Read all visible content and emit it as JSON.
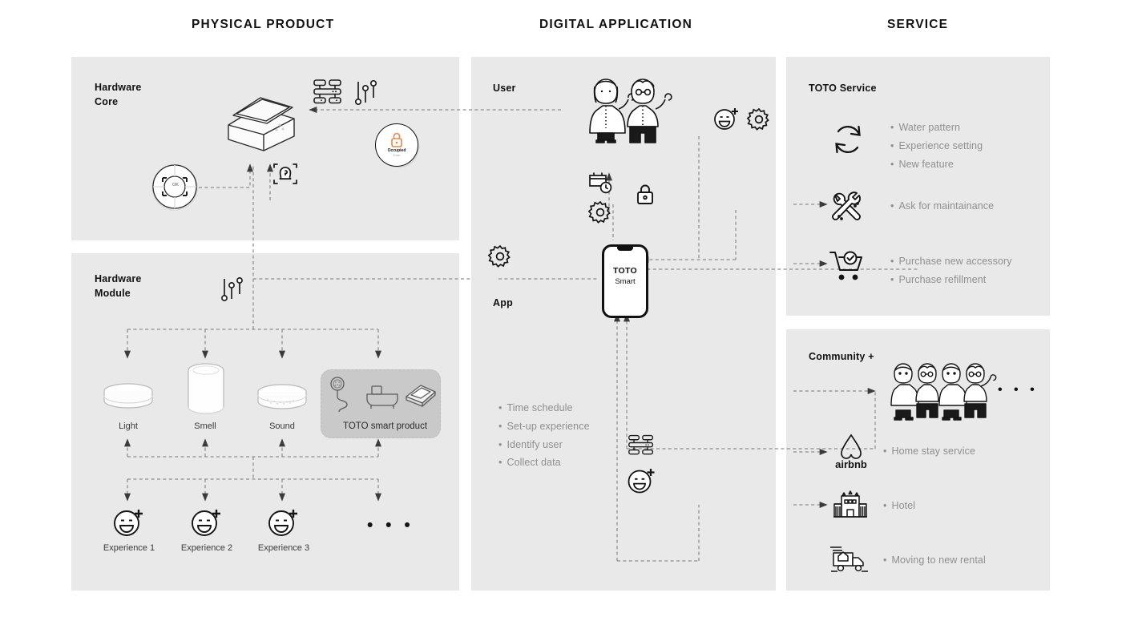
{
  "columns": [
    {
      "id": "physical",
      "label": "PHYSICAL PRODUCT"
    },
    {
      "id": "digital",
      "label": "DIGITAL APPLICATION"
    },
    {
      "id": "service",
      "label": "SERVICE"
    }
  ],
  "hardware_core": {
    "title_line1": "Hardware",
    "title_line2": "Core",
    "remote_label": "OK",
    "badge": {
      "title": "Occupied",
      "subtitle": "8 min"
    },
    "icons": [
      "server-stack-icon",
      "sliders-icon",
      "smart-toilet-icon",
      "dpad-remote-icon",
      "face-scan-icon",
      "lock-badge-icon"
    ]
  },
  "hardware_module": {
    "title_line1": "Hardware",
    "title_line2": "Module",
    "modules": [
      {
        "label": "Light",
        "icon": "light-puck-icon"
      },
      {
        "label": "Smell",
        "icon": "diffuser-icon"
      },
      {
        "label": "Sound",
        "icon": "speaker-puck-icon"
      }
    ],
    "toto_group": {
      "label": "TOTO smart  product",
      "icons": [
        "shower-head-icon",
        "bathtub-icon",
        "toilet-icon"
      ]
    },
    "experiences": [
      {
        "label": "Experience 1",
        "icon": "smiley-plus-icon"
      },
      {
        "label": "Experience 2",
        "icon": "smiley-plus-icon"
      },
      {
        "label": "Experience 3",
        "icon": "smiley-plus-icon"
      }
    ],
    "experiences_more": "• • •",
    "sliders_icon": "sliders-icon"
  },
  "digital": {
    "user_label": "User",
    "app_label": "App",
    "phone": {
      "brand": "TOTO",
      "product": "Smart"
    },
    "app_bullets": [
      "Time schedule",
      "Set-up experience",
      "Identify user",
      "Collect data"
    ],
    "icons": [
      "user-pair-icon",
      "smiley-plus-icon",
      "gear-icon",
      "calendar-clock-icon",
      "lock-icon",
      "server-stack-icon"
    ]
  },
  "service": {
    "title": "TOTO Service",
    "rows": [
      {
        "icon": "sync-refresh-icon",
        "bullets": [
          "Water pattern",
          "Experience setting",
          "New feature"
        ]
      },
      {
        "icon": "tools-icon",
        "bullets": [
          "Ask for maintainance"
        ]
      },
      {
        "icon": "cart-check-icon",
        "bullets": [
          "Purchase new accessory",
          "Purchase refillment"
        ]
      }
    ]
  },
  "community": {
    "title": "Community +",
    "people_icon": "people-group-icon",
    "more": "• • •",
    "rows": [
      {
        "icon": "airbnb-icon",
        "label": "airbnb",
        "bullet": "Home stay service"
      },
      {
        "icon": "hotel-icon",
        "label": "",
        "bullet": "Hotel"
      },
      {
        "icon": "moving-truck-icon",
        "label": "",
        "bullet": "Moving to new rental"
      }
    ]
  },
  "colors": {
    "panel": "#e9e9e9",
    "accent_orange": "#e8884a",
    "line": "#8a8a8a",
    "muted_text": "#8f8f8f",
    "group_box": "#c9c9c9"
  }
}
